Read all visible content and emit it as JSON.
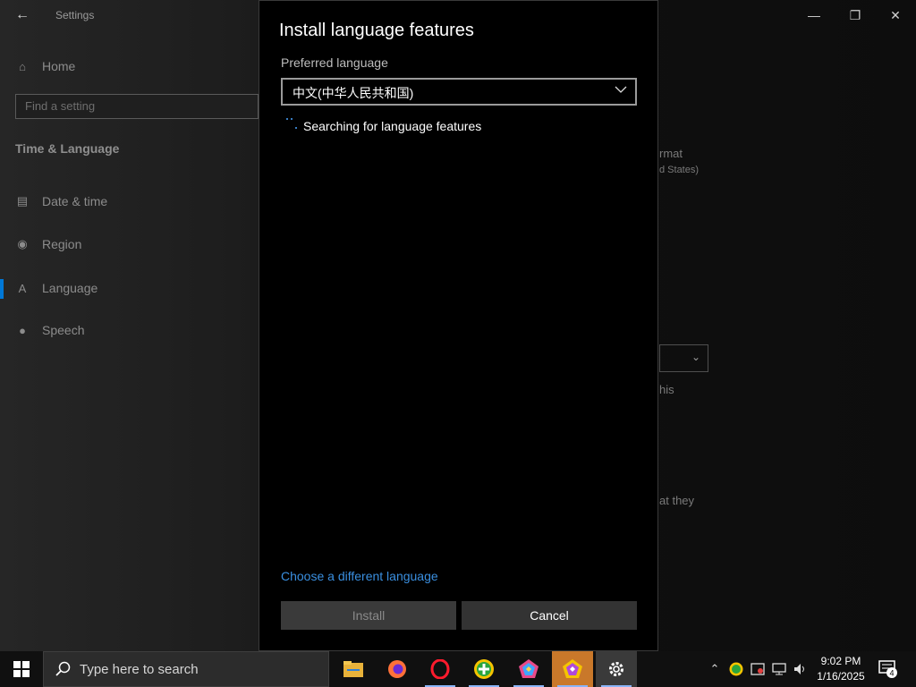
{
  "settings_window": {
    "title": "Settings",
    "nav": {
      "home": "Home",
      "search_placeholder": "Find a setting",
      "section": "Time & Language",
      "items": [
        "Date & time",
        "Region",
        "Language",
        "Speech"
      ]
    },
    "right_fragments": [
      "rmat",
      "d States)",
      "his",
      "at they"
    ]
  },
  "dialog": {
    "title": "Install language features",
    "preferred_label": "Preferred language",
    "selected_language": "中文(中华人民共和国)",
    "status": "Searching for language features",
    "different_language_link": "Choose a different language",
    "install_label": "Install",
    "cancel_label": "Cancel"
  },
  "taskbar": {
    "search_placeholder": "Type here to search",
    "time": "9:02 PM",
    "date": "1/16/2025",
    "notification_count": "4"
  },
  "colors": {
    "accent": "#0078d7",
    "link": "#3a8fe0"
  }
}
